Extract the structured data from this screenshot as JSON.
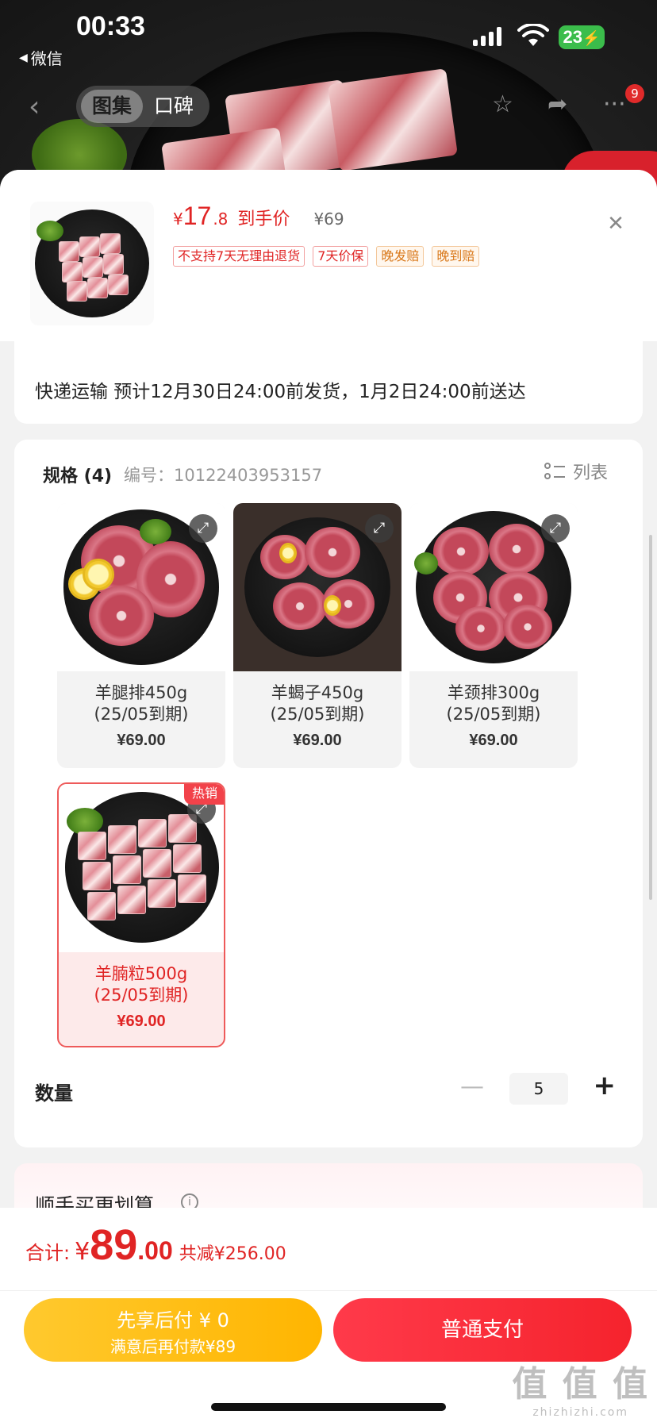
{
  "status_bar": {
    "time": "00:33",
    "back_app": "微信",
    "battery": "23"
  },
  "nav": {
    "tabs": [
      {
        "label": "图集",
        "active": true
      },
      {
        "label": "口碑",
        "active": false
      }
    ],
    "more_badge": "9"
  },
  "product": {
    "price_symbol": "¥",
    "price_int": "17",
    "price_dec": ".8",
    "price_label": "到手价",
    "original_price": "¥69",
    "tags": [
      {
        "label": "不支持7天无理由退货",
        "style": "red"
      },
      {
        "label": "7天价保",
        "style": "red"
      },
      {
        "label": "晚发赔",
        "style": "orange"
      },
      {
        "label": "晚到赔",
        "style": "orange"
      }
    ]
  },
  "shipping": {
    "text": "快递运输 预计12月30日24:00前发货，1月2日24:00前送达"
  },
  "spec": {
    "title": "规格 (4)",
    "code": "编号：10122403953157",
    "list_label": "列表",
    "items": [
      {
        "name": "羊腿排450g",
        "expiry": "(25/05到期)",
        "price": "¥69.00",
        "selected": false,
        "hot": ""
      },
      {
        "name": "羊蝎子450g",
        "expiry": "(25/05到期)",
        "price": "¥69.00",
        "selected": false,
        "hot": ""
      },
      {
        "name": "羊颈排300g",
        "expiry": "(25/05到期)",
        "price": "¥69.00",
        "selected": false,
        "hot": ""
      },
      {
        "name": "羊腩粒500g",
        "expiry": "(25/05到期)",
        "price": "¥69.00",
        "selected": true,
        "hot": "热销"
      }
    ]
  },
  "quantity": {
    "label": "数量",
    "minus": "—",
    "value": "5",
    "plus": "+"
  },
  "bundle": {
    "title": "顺手买更划算"
  },
  "footer": {
    "total_label": "合计:",
    "total_yen": "¥",
    "total_int": "89",
    "total_dec": ".00",
    "saved": "共减¥256.00",
    "pay_later_line1": "先享后付 ¥ 0",
    "pay_later_line2": "满意后再付款¥89",
    "pay_normal": "普通支付"
  },
  "watermark": {
    "big": "值 值 值",
    "small": "zhizhizhi.com"
  },
  "colors": {
    "accent_red": "#e02424",
    "pay_yellow": "#ffc92e",
    "pay_red": "#f5232d"
  }
}
